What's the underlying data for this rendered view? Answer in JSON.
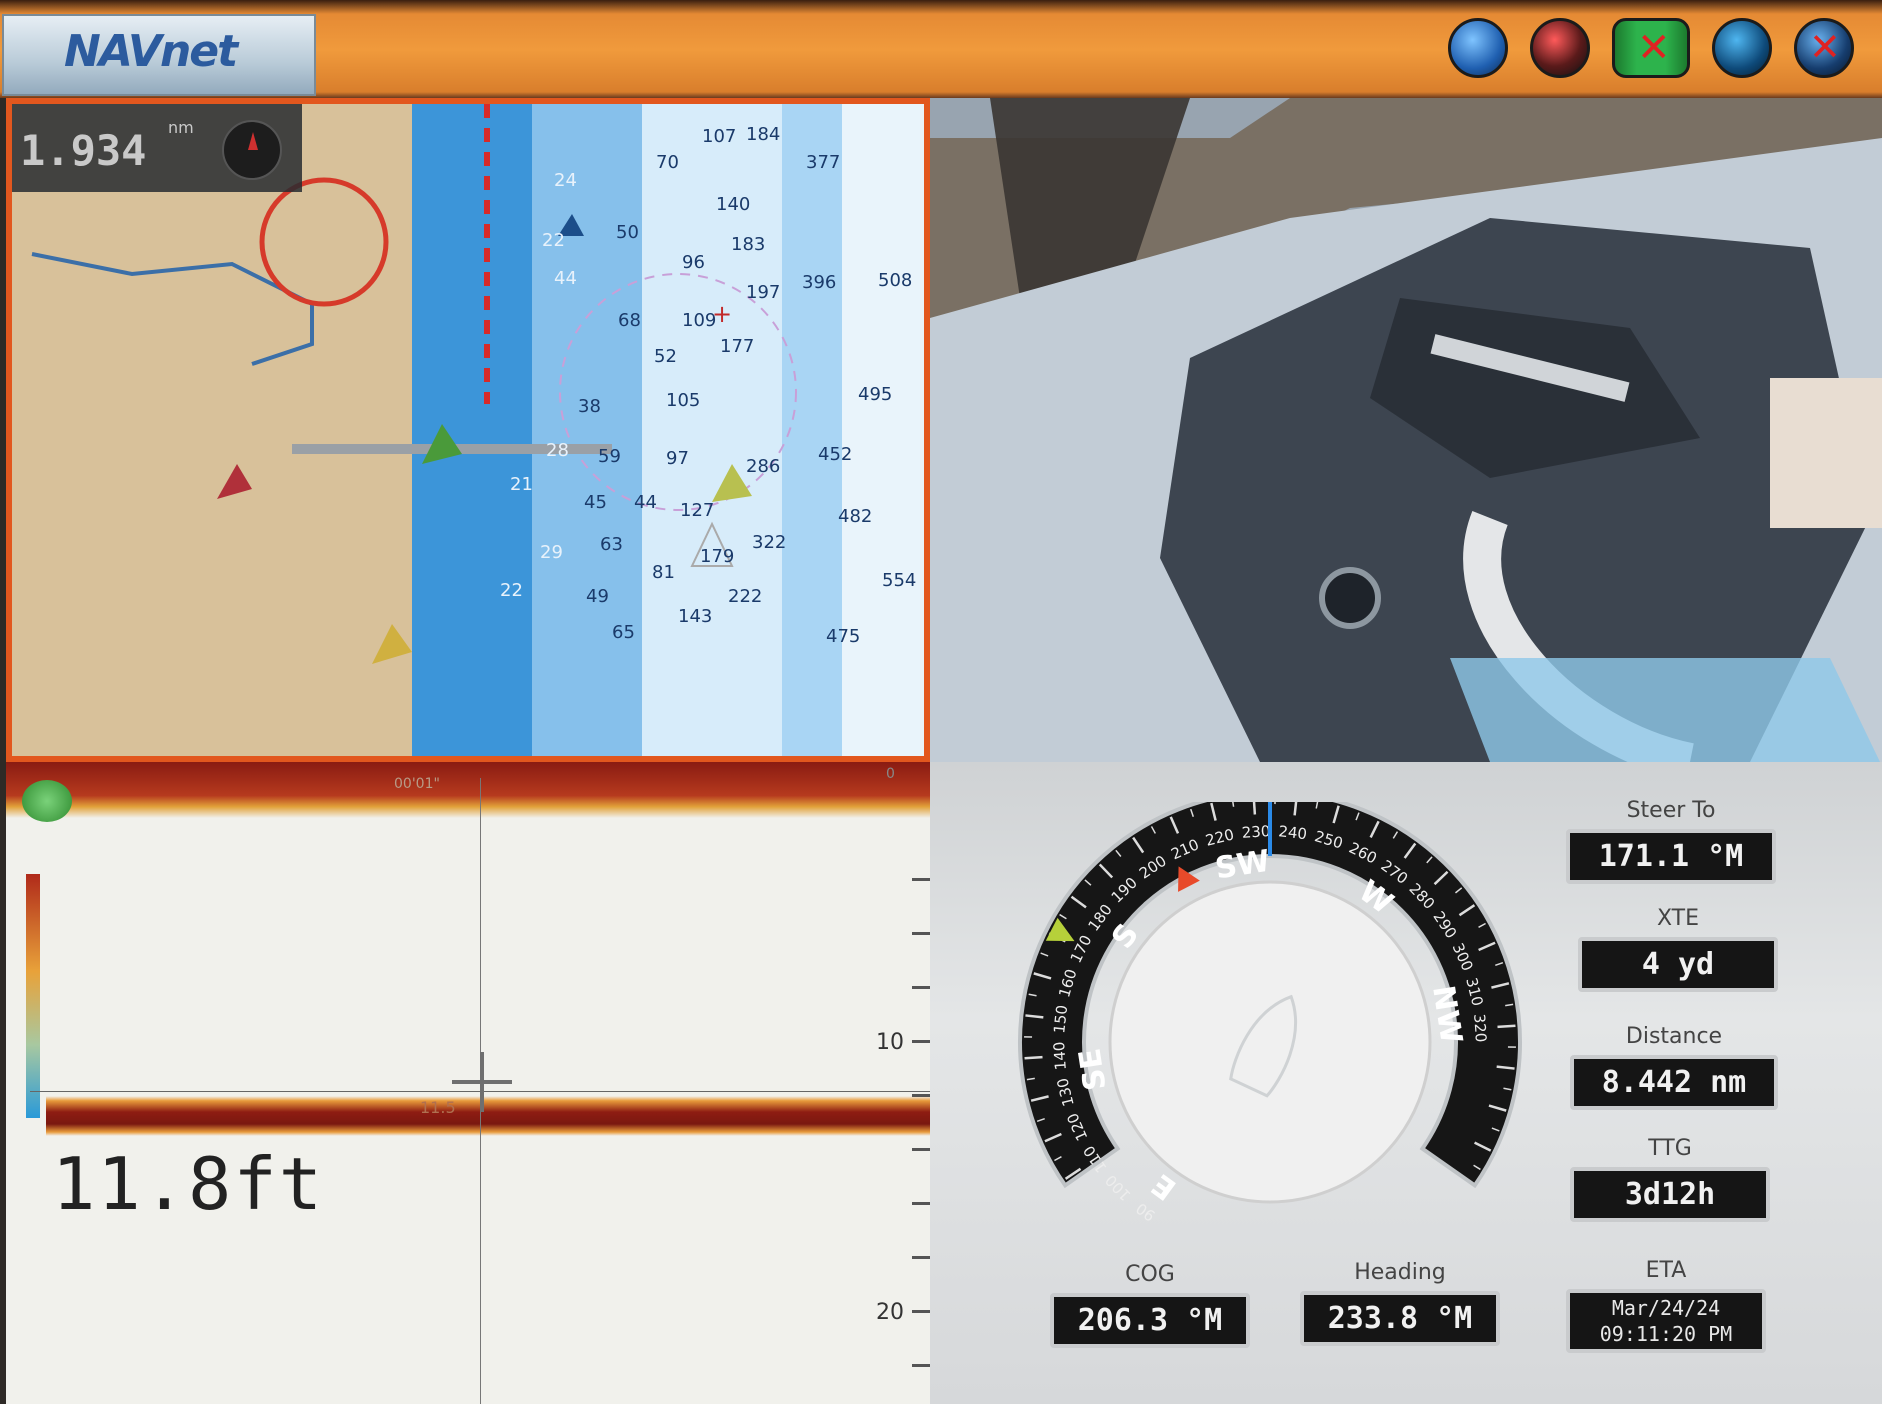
{
  "header": {
    "logo_text": "NAVnet",
    "icons": [
      "globe-icon",
      "compass-alert-icon",
      "network-disconnected-icon",
      "sonar-globe-icon",
      "gps-disconnected-icon"
    ]
  },
  "chart_pane": {
    "scale_value": "1.934",
    "scale_unit": "nm",
    "soundings": [
      {
        "v": "107"
      },
      {
        "v": "184"
      },
      {
        "v": "377"
      },
      {
        "v": "70"
      },
      {
        "v": "140"
      },
      {
        "v": "183"
      },
      {
        "v": "96"
      },
      {
        "v": "197"
      },
      {
        "v": "396"
      },
      {
        "v": "508"
      },
      {
        "v": "109"
      },
      {
        "v": "177"
      },
      {
        "v": "68"
      },
      {
        "v": "52"
      },
      {
        "v": "105"
      },
      {
        "v": "495"
      },
      {
        "v": "38"
      },
      {
        "v": "59"
      },
      {
        "v": "97"
      },
      {
        "v": "286"
      },
      {
        "v": "452"
      },
      {
        "v": "45"
      },
      {
        "v": "44"
      },
      {
        "v": "127"
      },
      {
        "v": "482"
      },
      {
        "v": "63"
      },
      {
        "v": "179"
      },
      {
        "v": "322"
      },
      {
        "v": "81"
      },
      {
        "v": "222"
      },
      {
        "v": "554"
      },
      {
        "v": "49"
      },
      {
        "v": "143"
      },
      {
        "v": "65"
      },
      {
        "v": "475"
      },
      {
        "v": "50"
      },
      {
        "v": "44"
      },
      {
        "v": "24"
      },
      {
        "v": "22"
      },
      {
        "v": "28"
      },
      {
        "v": "21"
      },
      {
        "v": "29"
      },
      {
        "v": "22"
      }
    ]
  },
  "sonar_pane": {
    "time_label": "00'01\"",
    "range_top": "0",
    "depth_labels": [
      "10",
      "20"
    ],
    "cursor_depth": "11.5",
    "depth_readout": "11.8ft"
  },
  "nav_pane": {
    "compass": {
      "degree_labels": [
        "90",
        "100",
        "110",
        "120",
        "130",
        "140",
        "150",
        "160",
        "170",
        "180",
        "190",
        "200",
        "210",
        "220",
        "230",
        "240",
        "250",
        "260",
        "270",
        "280",
        "290",
        "300",
        "310",
        "320"
      ],
      "cardinals": [
        "E",
        "SE",
        "S",
        "SW",
        "W",
        "NW"
      ],
      "heading_deg": 233.8,
      "cog_deg": 206.3,
      "steer_deg": 171.1
    },
    "steer_to": {
      "label": "Steer To",
      "value": "171.1 °M"
    },
    "xte": {
      "label": "XTE",
      "value": "4 yd"
    },
    "distance": {
      "label": "Distance",
      "value": "8.442 nm"
    },
    "ttg": {
      "label": "TTG",
      "value": "3d12h"
    },
    "cog": {
      "label": "COG",
      "value": "206.3 °M"
    },
    "heading": {
      "label": "Heading",
      "value": "233.8 °M"
    },
    "eta": {
      "label": "ETA",
      "date": "Mar/24/24",
      "time": "09:11:20 PM"
    }
  }
}
